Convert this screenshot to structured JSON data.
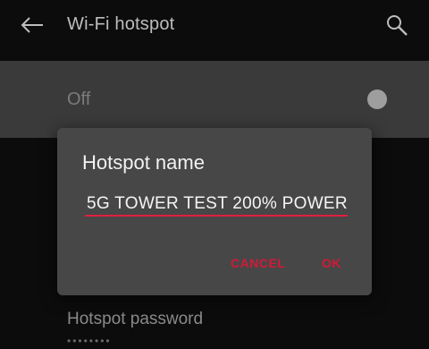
{
  "appbar": {
    "title": "Wi-Fi hotspot",
    "back_icon": "arrow-left-icon",
    "search_icon": "search-icon"
  },
  "toggle": {
    "label": "Off",
    "state": "off"
  },
  "password": {
    "label": "Hotspot password",
    "masked_value": "••••••••"
  },
  "dialog": {
    "title": "Hotspot name",
    "input_value": "5G TOWER TEST 200% POWER",
    "cancel_label": "CANCEL",
    "ok_label": "OK"
  },
  "colors": {
    "accent": "#d11a38",
    "dialog_bg": "#474747",
    "row_bg": "#3a3a3a",
    "background": "#0c0c0c"
  }
}
